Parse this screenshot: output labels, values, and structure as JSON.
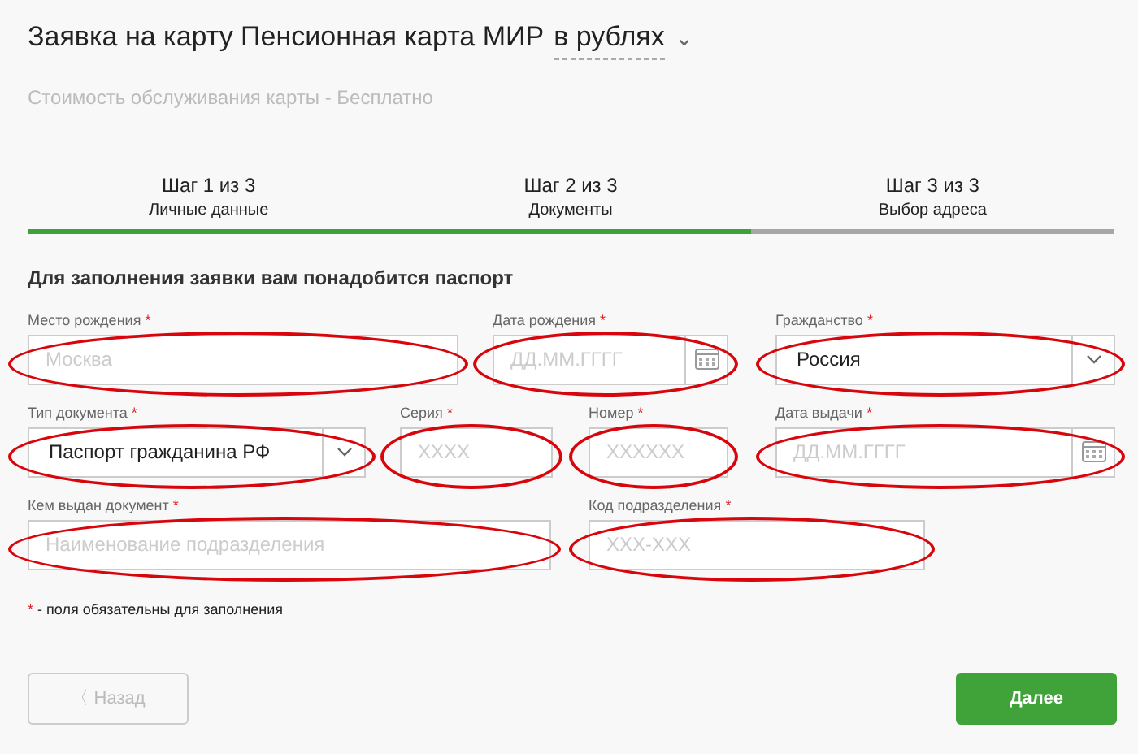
{
  "title": "Заявка на карту Пенсионная карта МИР",
  "currency": {
    "label": "в рублях",
    "caret": "⌄"
  },
  "subtitle": "Стоимость обслуживания карты - Бесплатно",
  "steps": [
    {
      "step": "Шаг 1 из 3",
      "name": "Личные данные",
      "done": true
    },
    {
      "step": "Шаг 2 из 3",
      "name": "Документы",
      "done": true
    },
    {
      "step": "Шаг 3 из 3",
      "name": "Выбор адреса",
      "done": false
    }
  ],
  "section_title": "Для заполнения заявки вам понадобится паспорт",
  "rows": [
    {
      "fields": [
        {
          "label": "Место рождения",
          "required": true,
          "kind": "text",
          "placeholder": "Москва",
          "circled": true
        },
        {
          "label": "Дата рождения",
          "required": true,
          "kind": "date",
          "placeholder": "ДД.ММ.ГГГГ",
          "circled": true
        },
        {
          "label": "Гражданство",
          "required": true,
          "kind": "select",
          "value": "Россия",
          "circled": true
        }
      ]
    },
    {
      "fields": [
        {
          "label": "Тип документа",
          "required": true,
          "kind": "select",
          "value": "Паспорт гражданина РФ",
          "circled": true
        },
        {
          "label": "Серия",
          "required": true,
          "kind": "text",
          "placeholder": "XXXX",
          "circled": true
        },
        {
          "label": "Номер",
          "required": true,
          "kind": "text",
          "placeholder": "XXXXXX",
          "circled": true
        },
        {
          "label": "Дата выдачи",
          "required": true,
          "kind": "date",
          "placeholder": "ДД.ММ.ГГГГ",
          "circled": true
        }
      ]
    },
    {
      "fields": [
        {
          "label": "Кем выдан документ",
          "required": true,
          "kind": "text",
          "placeholder": "Наименование подразделения",
          "circled": true
        },
        {
          "label": "Код подразделения",
          "required": true,
          "kind": "text",
          "placeholder": "XXX-XXX",
          "circled": true
        }
      ]
    }
  ],
  "note": {
    "mark": "*",
    "text": "- поля обязательны для заполнения"
  },
  "buttons": [
    {
      "kind": "back",
      "icon": "〈",
      "label": "Назад",
      "disabled": true
    },
    {
      "kind": "next",
      "label": "Далее",
      "disabled": false
    }
  ]
}
